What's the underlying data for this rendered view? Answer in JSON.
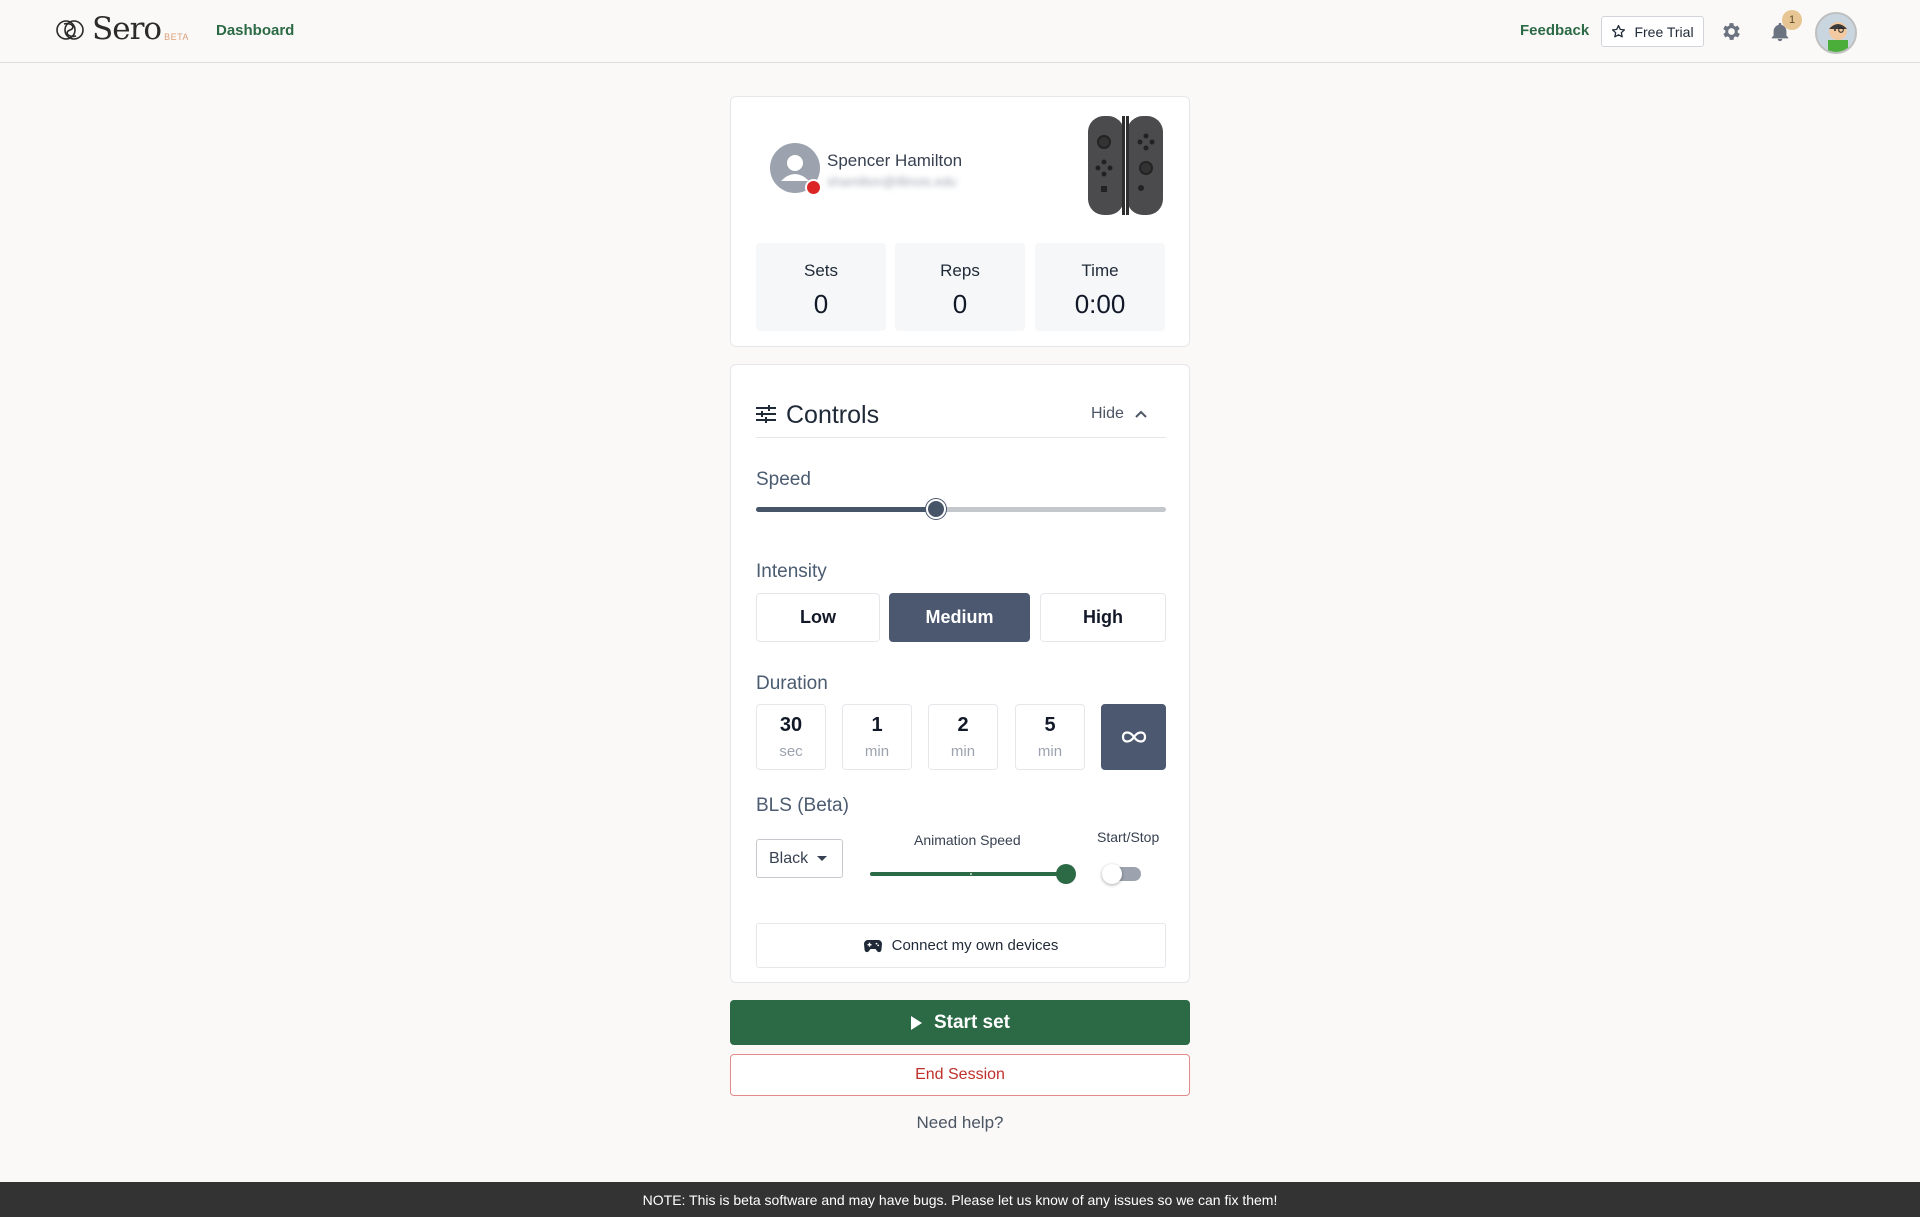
{
  "header": {
    "logo_text": "Sero",
    "logo_badge": "BETA",
    "nav_dashboard": "Dashboard",
    "feedback_label": "Feedback",
    "free_trial_label": "Free Trial",
    "notification_count": "1",
    "icons": [
      "sero-logo-icon",
      "star-icon",
      "gear-icon",
      "bell-icon",
      "avatar"
    ]
  },
  "session": {
    "user_name": "Spencer Hamilton",
    "user_email": "shamilton@illinois.edu",
    "status_color": "#dc2626",
    "device_icon": "joy-con-controller-icon",
    "stats": [
      {
        "label": "Sets",
        "value": "0"
      },
      {
        "label": "Reps",
        "value": "0"
      },
      {
        "label": "Time",
        "value": "0:00"
      }
    ]
  },
  "controls": {
    "title": "Controls",
    "hide_label": "Hide",
    "speed": {
      "label": "Speed",
      "value_fraction": 0.44
    },
    "intensity": {
      "label": "Intensity",
      "options": [
        "Low",
        "Medium",
        "High"
      ],
      "selected": "Medium"
    },
    "duration": {
      "label": "Duration",
      "options": [
        {
          "num": "30",
          "unit": "sec"
        },
        {
          "num": "1",
          "unit": "min"
        },
        {
          "num": "2",
          "unit": "min"
        },
        {
          "num": "5",
          "unit": "min"
        }
      ],
      "selected": "infinity"
    },
    "bls": {
      "label": "BLS (Beta)",
      "color_select": "Black",
      "animation_speed_label": "Animation Speed",
      "animation_speed_fraction": 0.97,
      "start_stop_label": "Start/Stop",
      "toggle_on": false
    },
    "connect_label": "Connect my own devices"
  },
  "actions": {
    "start_label": "Start set",
    "end_label": "End Session",
    "help_label": "Need help?"
  },
  "footer": {
    "note": "NOTE: This is beta software and may have bugs. Please let us know of any issues so we can fix them!"
  },
  "colors": {
    "brand_green": "#2c6a46",
    "selected_slate": "#4b5870",
    "danger_red": "#c0302b"
  }
}
